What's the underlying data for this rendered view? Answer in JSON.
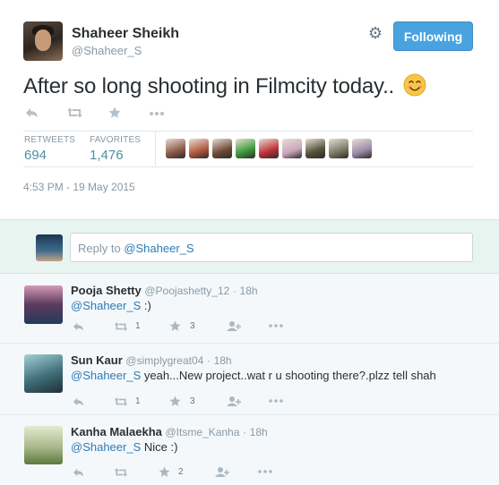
{
  "tweet": {
    "author_name": "Shaheer Sheikh",
    "author_handle": "@Shaheer_S",
    "follow_label": "Following",
    "text": "After so long shooting in Filmcity today..",
    "emoji": "smiling-face-emoji",
    "retweets_label": "RETWEETS",
    "retweets_count": "694",
    "favorites_label": "FAVORITES",
    "favorites_count": "1,476",
    "timestamp": "4:53 PM - 19 May 2015",
    "actions": [
      "reply-icon",
      "retweet-icon",
      "favorite-icon",
      "more-icon"
    ]
  },
  "favoriters": [
    {
      "name": "favoriter-avatar-1",
      "color": "#8a5a4a"
    },
    {
      "name": "favoriter-avatar-2",
      "color": "#b0583c"
    },
    {
      "name": "favoriter-avatar-3",
      "color": "#6d4a36"
    },
    {
      "name": "favoriter-avatar-4",
      "color": "#3a9a3a"
    },
    {
      "name": "favoriter-avatar-5",
      "color": "#c0303a"
    },
    {
      "name": "favoriter-avatar-6",
      "color": "#c9a5b8"
    },
    {
      "name": "favoriter-avatar-7",
      "color": "#55523a"
    },
    {
      "name": "favoriter-avatar-8",
      "color": "#7a7a66"
    },
    {
      "name": "favoriter-avatar-9",
      "color": "#9a8aa8"
    }
  ],
  "reply_box": {
    "prefix": "Reply to ",
    "mention": "@Shaheer_S"
  },
  "replies": [
    {
      "name": "Pooja Shetty",
      "handle": "@Poojashetty_12",
      "time": "18h",
      "mention": "@Shaheer_S",
      "text": " :)",
      "retweets": "1",
      "favorites": "3",
      "avatar_color": "#5b3a5e"
    },
    {
      "name": "Sun Kaur",
      "handle": "@simplygreat04",
      "time": "18h",
      "mention": "@Shaheer_S",
      "text": " yeah...New project..wat r u shooting there?.plzz tell shah",
      "retweets": "1",
      "favorites": "3",
      "avatar_color": "#3f6f7a"
    },
    {
      "name": "Kanha Malaekha",
      "handle": "@Itsme_Kanha",
      "time": "18h",
      "mention": "@Shaheer_S",
      "text": " Nice :)",
      "retweets": "",
      "favorites": "2",
      "avatar_color": "#a9b88a"
    }
  ],
  "colors": {
    "follow_button": "#4aa3df",
    "link": "#2b7bb9",
    "stat_value": "#4c8fa5",
    "reply_area_bg": "#e8f4f0"
  }
}
